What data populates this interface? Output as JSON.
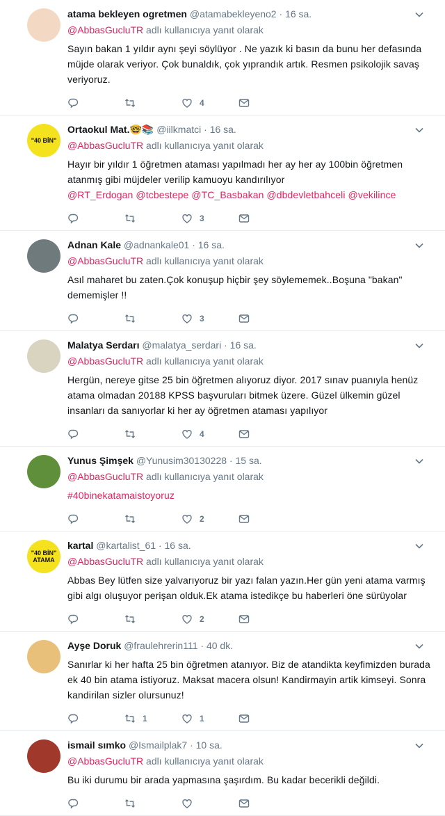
{
  "tweets": [
    {
      "name": "atama bekleyen ogretmen",
      "handle": "@atamabekleyeno2",
      "time": "16 sa.",
      "reply_prefix": "@AbbasGucluTR",
      "reply_suffix": " adlı kullanıcıya yanıt olarak",
      "text": "Sayın bakan  1 yıldır aynı şeyi söylüyor .  Ne yazık ki basın da bunu her defasında müjde olarak veriyor. Çok bunaldık, çok yıprandık artık. Resmen psikolojik savaş veriyoruz.",
      "reply_count": "",
      "retweet_count": "",
      "like_count": "4",
      "avatar_text": "",
      "avatar_color": "#f3d9c4"
    },
    {
      "name": "Ortaokul Mat.",
      "name_emoji": "🤓📚",
      "handle": "@iilkmatci",
      "time": "16 sa.",
      "reply_prefix": "@AbbasGucluTR",
      "reply_suffix": " adlı kullanıcıya yanıt olarak",
      "text": "Hayır bir yıldır 1 öğretmen ataması yapılmadı her ay her ay 100bin öğretmen atanmış gibi müjdeler verilip kamuoyu kandırılıyor",
      "text_links": "@RT_Erdogan @tcbestepe @TC_Basbakan @dbdevletbahceli @vekilince",
      "reply_count": "",
      "retweet_count": "",
      "like_count": "3",
      "avatar_text": "\"40 BİN\"",
      "avatar_color": "#f5e21f"
    },
    {
      "name": "Adnan Kale",
      "handle": "@adnankale01",
      "time": "16 sa.",
      "reply_prefix": "@AbbasGucluTR",
      "reply_suffix": " adlı kullanıcıya yanıt olarak",
      "text": "Asıl maharet bu zaten.Çok konuşup hiçbir şey söylememek..Boşuna \"bakan\" dememişler !!",
      "reply_count": "",
      "retweet_count": "",
      "like_count": "3",
      "avatar_text": "",
      "avatar_color": "#6f7a7c"
    },
    {
      "name": "Malatya Serdarı",
      "handle": "@malatya_serdari",
      "time": "16 sa.",
      "reply_prefix": "@AbbasGucluTR",
      "reply_suffix": " adlı kullanıcıya yanıt olarak",
      "text": "Hergün, nereye gitse 25 bin öğretmen alıyoruz diyor. 2017 sınav puanıyla henüz atama olmadan 20188 KPSS başvuruları bitmek üzere. Güzel ülkemin güzel insanları da sanıyorlar ki her ay öğretmen ataması yapılıyor",
      "reply_count": "",
      "retweet_count": "",
      "like_count": "4",
      "avatar_text": "",
      "avatar_color": "#d9d4c0"
    },
    {
      "name": "Yunus Şimşek",
      "handle": "@Yunusim30130228",
      "time": "15 sa.",
      "reply_prefix": "@AbbasGucluTR",
      "reply_suffix": " adlı kullanıcıya yanıt olarak",
      "text": "",
      "text_links": "#40binekatamaistoyoruz",
      "reply_count": "",
      "retweet_count": "",
      "like_count": "2",
      "avatar_text": "",
      "avatar_color": "#5f8f3a"
    },
    {
      "name": "kartal",
      "handle": "@kartalist_61",
      "time": "16 sa.",
      "reply_prefix": "@AbbasGucluTR",
      "reply_suffix": " adlı kullanıcıya yanıt olarak",
      "text": "Abbas Bey lütfen size yalvarıyoruz bir yazı falan yazın.Her gün yeni atama varmış gibi algı oluşuyor perişan olduk.Ek atama istedikçe bu haberleri öne sürüyolar",
      "reply_count": "",
      "retweet_count": "",
      "like_count": "2",
      "avatar_text": "\"40 BİN\" ATAMA",
      "avatar_color": "#f5e21f"
    },
    {
      "name": "Ayşe Doruk",
      "handle": "@fraulehrerin111",
      "time": "40 dk.",
      "reply_prefix": "",
      "reply_suffix": "",
      "text": "Sanırlar ki her hafta 25 bin öğretmen atanıyor. Biz de atandikta keyfimizden burada ek 40 bin atama istiyoruz. Maksat macera olsun! Kandirmayin artik kimseyi. Sonra kandirilan sizler olursunuz!",
      "reply_count": "",
      "retweet_count": "1",
      "like_count": "1",
      "avatar_text": "",
      "avatar_color": "#e8c07a"
    },
    {
      "name": "ismail sımko",
      "handle": "@Ismailplak7",
      "time": "10 sa.",
      "reply_prefix": "@AbbasGucluTR",
      "reply_suffix": " adlı kullanıcıya yanıt olarak",
      "text": "Bu iki durumu bir arada yapmasına şaşırdım. Bu kadar becerikli değildi.",
      "reply_count": "",
      "retweet_count": "",
      "like_count": "",
      "avatar_text": "",
      "avatar_color": "#a0382c"
    }
  ],
  "dot": "·"
}
